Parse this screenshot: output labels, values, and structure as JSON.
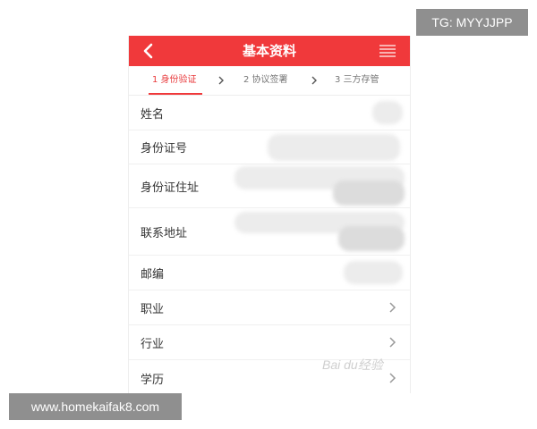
{
  "overlay": {
    "top_right_badge": "TG: MYYJJPP",
    "bottom_left_badge": "www.homekaifak8.com",
    "watermark": "Bai du经验"
  },
  "header": {
    "title": "基本资料",
    "back_icon": "chevron-left-icon",
    "menu_icon": "list-menu-icon",
    "background_color": "#f0393b"
  },
  "steps": [
    {
      "label": "1 身份验证",
      "active": true
    },
    {
      "label": "2 协议签署",
      "active": false
    },
    {
      "label": "3 三方存管",
      "active": false
    }
  ],
  "form": {
    "rows": [
      {
        "label": "姓名"
      },
      {
        "label": "身份证号"
      },
      {
        "label": "身份证住址"
      },
      {
        "label": "联系地址"
      },
      {
        "label": "邮编"
      },
      {
        "label": "职业"
      },
      {
        "label": "行业"
      },
      {
        "label": "学历"
      }
    ]
  }
}
